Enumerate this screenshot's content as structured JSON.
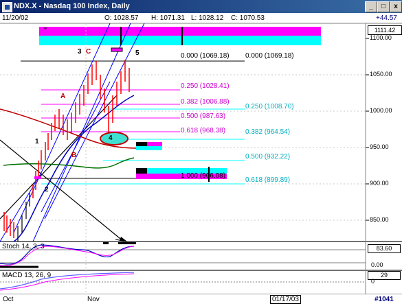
{
  "window": {
    "title": "NDX.X - Nasdaq 100 Index, Daily",
    "btn_min": "_",
    "btn_max": "□",
    "btn_close": "x"
  },
  "header": {
    "date": "11/20/02",
    "open": "O: 1028.57",
    "high": "H: 1071.31",
    "low": "L: 1028.12",
    "close": "C: 1070.53",
    "change": "+44.57"
  },
  "price_axis": {
    "current": "1111.42",
    "ticks": [
      "1100.00",
      "1050.00",
      "1000.00",
      "950.00",
      "900.00",
      "850.00"
    ]
  },
  "fib_left": [
    {
      "label": "0.000 (1069.18)",
      "color": "#000000"
    },
    {
      "label": "0.250 (1028.41)",
      "color": "#d000d0"
    },
    {
      "label": "0.382 (1006.88)",
      "color": "#d000d0"
    },
    {
      "label": "0.500 (987.63)",
      "color": "#d000d0"
    },
    {
      "label": "0.618 (968.38)",
      "color": "#d000d0"
    },
    {
      "label": "1.000 (906.08)",
      "color": "#000000"
    }
  ],
  "fib_right": [
    {
      "label": "0.000 (1069.18)",
      "color": "#000000"
    },
    {
      "label": "0.250 (1008.70)",
      "color": "#00c0d0"
    },
    {
      "label": "0.382 (964.54)",
      "color": "#00c0d0"
    },
    {
      "label": "0.500 (932.22)",
      "color": "#00c0d0"
    },
    {
      "label": "0.618 (899.89)",
      "color": "#00c0d0"
    }
  ],
  "waves": {
    "w1": "1",
    "w2": "2",
    "w3": "3",
    "w4": "4",
    "w5": "5",
    "wa": "A",
    "wb": "B",
    "wc": "C"
  },
  "stoch": {
    "label": "Stoch 14, 3, 3",
    "value": "83.60",
    "zero": "0.00"
  },
  "macd": {
    "label": "MACD 13, 26, 9",
    "value": "29",
    "zero": "0"
  },
  "time_axis": {
    "oct": "Oct",
    "nov": "Nov",
    "end_date": "01/17/03",
    "id": "#1041"
  },
  "colors": {
    "magenta": "#ff00ff",
    "cyan": "#00ffff",
    "up_bar": "#ff0000",
    "channel": "#0000ff",
    "ma_red": "#c00000",
    "ma_green": "#007000",
    "stoch": "#0000c0",
    "macd": "#6060ff"
  }
}
